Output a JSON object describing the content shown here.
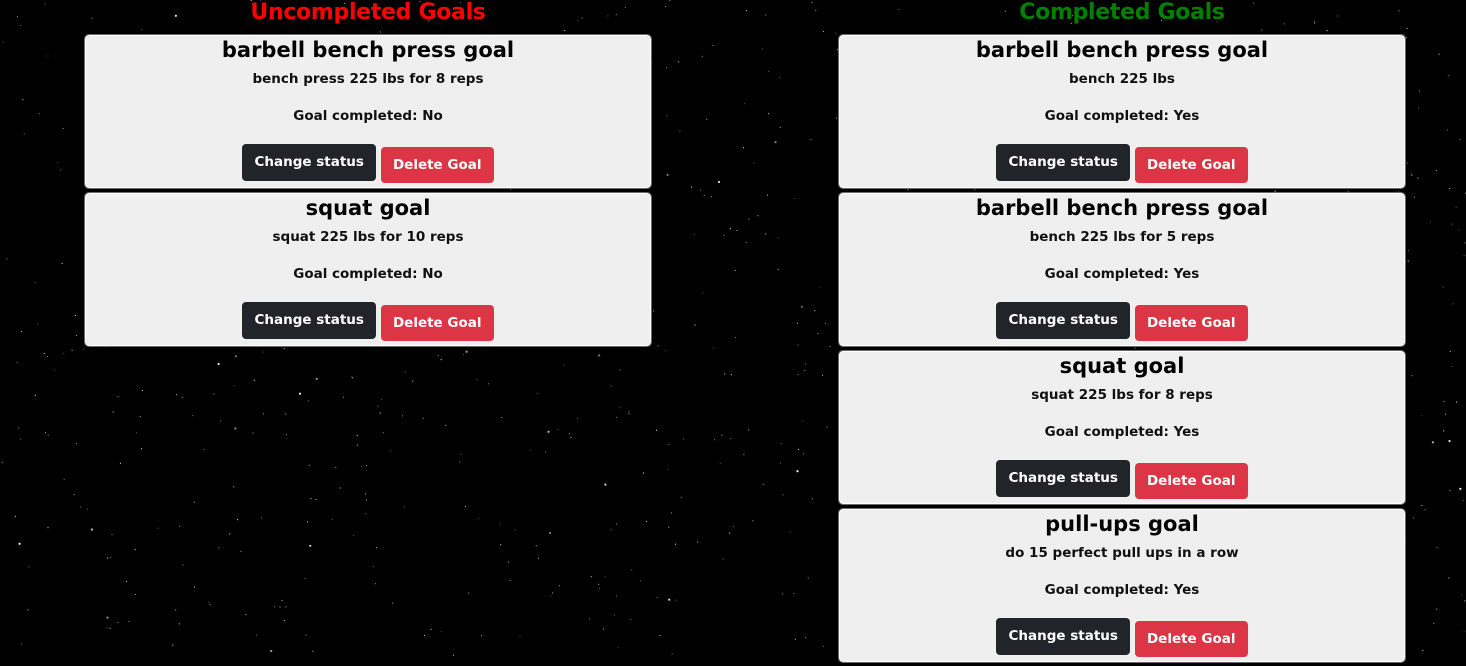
{
  "colors": {
    "uncompleted_heading": "#ff0000",
    "completed_heading": "#008000",
    "card_bg": "#efefef",
    "change_button": "#212529",
    "delete_button": "#dc3545"
  },
  "uncompleted": {
    "heading": "Uncompleted Goals",
    "goals": [
      {
        "title": "barbell bench press goal",
        "description": "bench press 225 lbs for 8 reps",
        "status": "Goal completed: No",
        "change_label": "Change status",
        "delete_label": "Delete Goal"
      },
      {
        "title": "squat goal",
        "description": "squat 225 lbs for 10 reps",
        "status": "Goal completed: No",
        "change_label": "Change status",
        "delete_label": "Delete Goal"
      }
    ]
  },
  "completed": {
    "heading": "Completed Goals",
    "goals": [
      {
        "title": "barbell bench press goal",
        "description": "bench 225 lbs",
        "status": "Goal completed: Yes",
        "change_label": "Change status",
        "delete_label": "Delete Goal"
      },
      {
        "title": "barbell bench press goal",
        "description": "bench 225 lbs for 5 reps",
        "status": "Goal completed: Yes",
        "change_label": "Change status",
        "delete_label": "Delete Goal"
      },
      {
        "title": "squat goal",
        "description": "squat 225 lbs for 8 reps",
        "status": "Goal completed: Yes",
        "change_label": "Change status",
        "delete_label": "Delete Goal"
      },
      {
        "title": "pull-ups goal",
        "description": "do 15 perfect pull ups in a row",
        "status": "Goal completed: Yes",
        "change_label": "Change status",
        "delete_label": "Delete Goal"
      }
    ]
  }
}
